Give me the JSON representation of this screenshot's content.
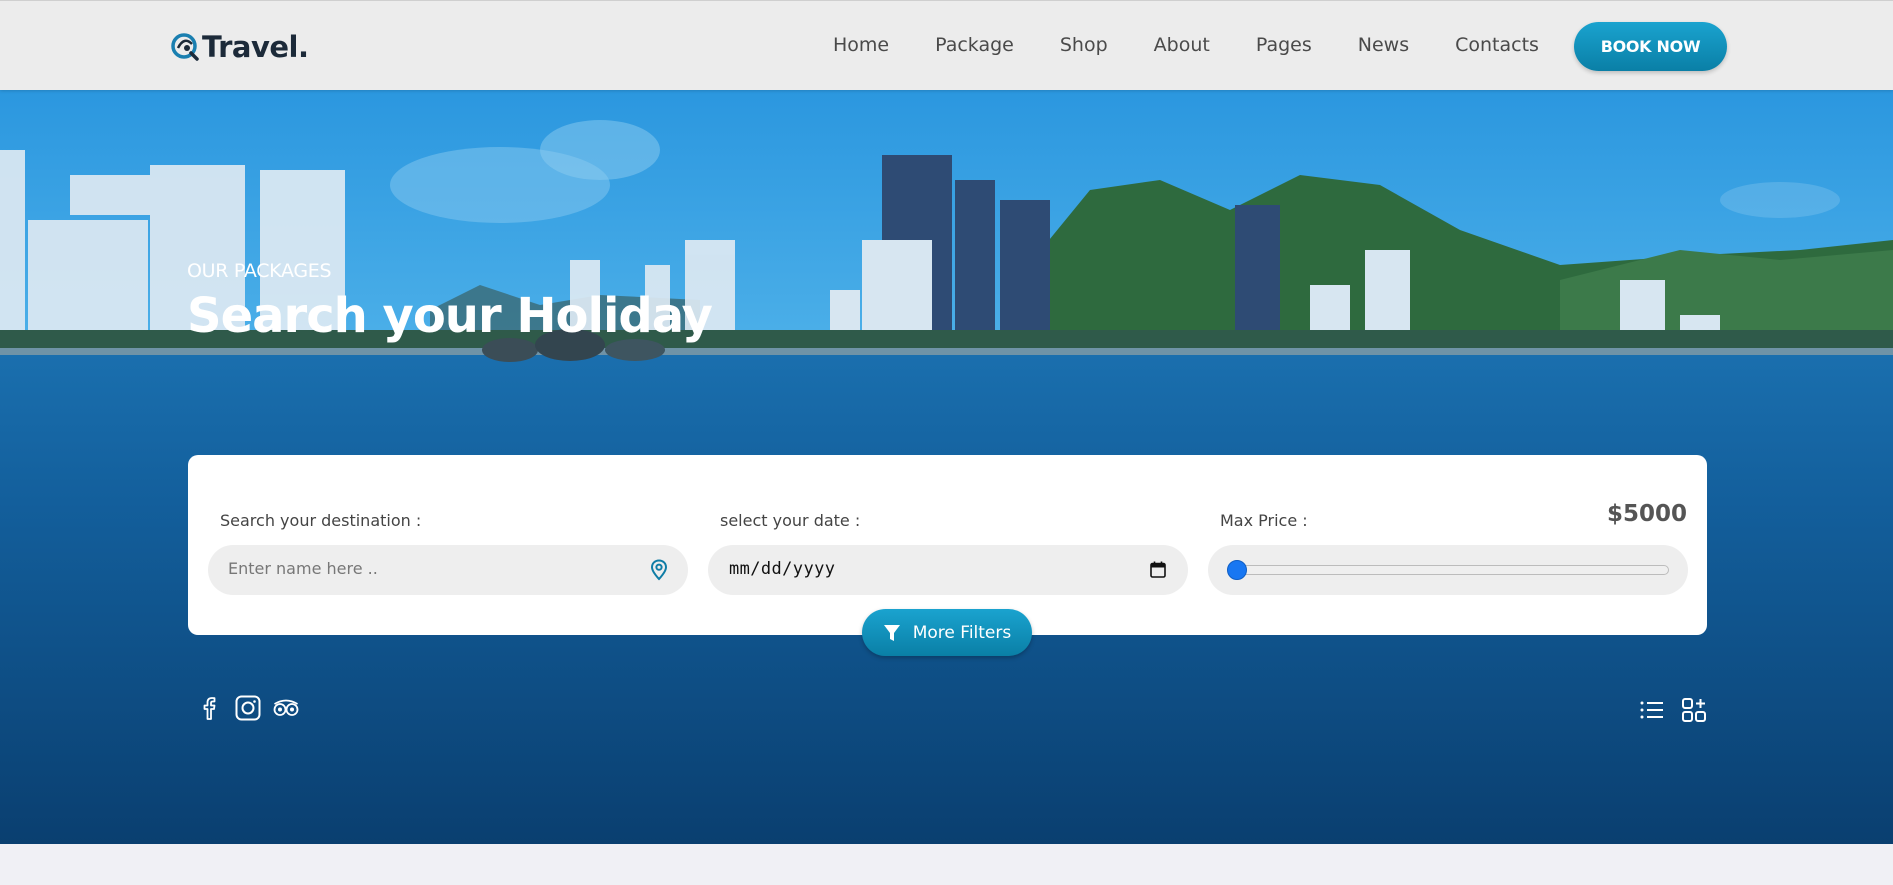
{
  "header": {
    "logo_text": "Travel.",
    "nav": [
      "Home",
      "Package",
      "Shop",
      "About",
      "Pages",
      "News",
      "Contacts"
    ],
    "book_label": "BOOK NOW"
  },
  "hero": {
    "eyebrow": "OUR PACKAGES",
    "title": "Search your Holiday"
  },
  "search": {
    "destination_label": "Search your destination :",
    "destination_placeholder": "Enter name here ..",
    "date_label": "select your date :",
    "date_placeholder": "mm/dd/yyyy",
    "price_label": "Max Price :",
    "price_value": "$5000",
    "price_slider_fraction": 0.0,
    "more_filters_label": "More Filters"
  },
  "social_icons": [
    "facebook-icon",
    "instagram-icon",
    "tripadvisor-icon"
  ],
  "view_icons": [
    "list-view-icon",
    "grid-view-icon"
  ],
  "colors": {
    "accent": "#1196c4",
    "slider": "#1877f2",
    "logo_text": "#1c2a39"
  }
}
